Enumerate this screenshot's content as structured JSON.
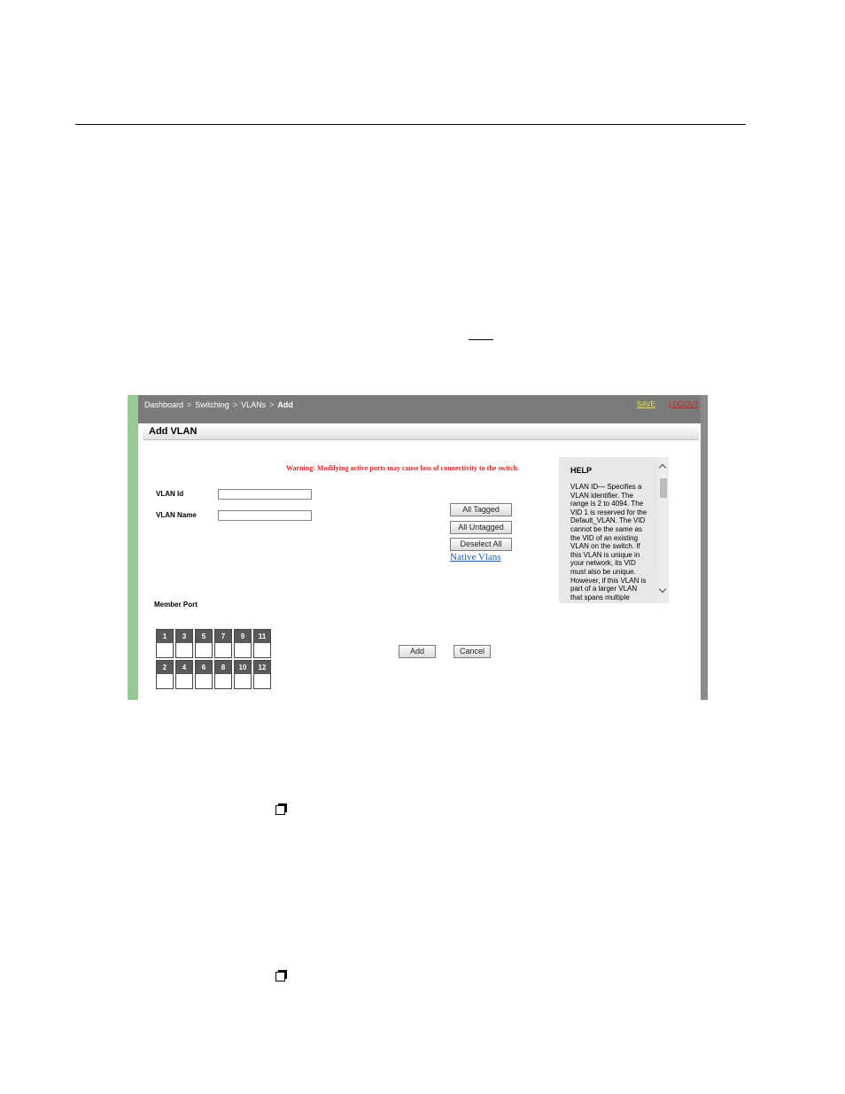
{
  "breadcrumb": {
    "items": [
      "Dashboard",
      "Switching",
      "VLANs"
    ],
    "separator": ">",
    "current": "Add"
  },
  "header_links": {
    "save": "SAVE",
    "logout": "LOGOUT"
  },
  "panel": {
    "title": "Add VLAN"
  },
  "warning": "Warning: Modifying active ports may cause loss of connectivity to the switch.",
  "form": {
    "vlan_id_label": "VLAN Id",
    "vlan_id_value": "",
    "vlan_name_label": "VLAN Name",
    "vlan_name_value": ""
  },
  "buttons": {
    "all_tagged": "All Tagged",
    "all_untagged": "All Untagged",
    "deselect_all": "Deselect All",
    "native_vlans": "Native Vlans",
    "add": "Add",
    "cancel": "Cancel"
  },
  "member_port_label": "Member Port",
  "ports": {
    "top_row": [
      "1",
      "3",
      "5",
      "7",
      "9",
      "11"
    ],
    "bottom_row": [
      "2",
      "4",
      "6",
      "8",
      "10",
      "12"
    ]
  },
  "help": {
    "title": "HELP",
    "lines": [
      "VLAN ID— Specifies a",
      "VLAN identifier. The",
      "range is 2 to 4094. The",
      "VID 1 is reserved for the",
      "Default_VLAN. The VID",
      "cannot be the same as",
      "the VID of an existing",
      "VLAN on the switch. If",
      "this VLAN is unique in",
      "your network, its VID",
      "must also be unique.",
      "However, if this VLAN is",
      "part of a larger VLAN",
      "that spans multiple"
    ]
  },
  "colors": {
    "topbar": "#7b7b7b",
    "left_accent": "#96c993",
    "warning": "#e02020",
    "save_link": "#e8e43a",
    "logout_link": "#cf1b1b",
    "port_header": "#5a5a5a"
  }
}
